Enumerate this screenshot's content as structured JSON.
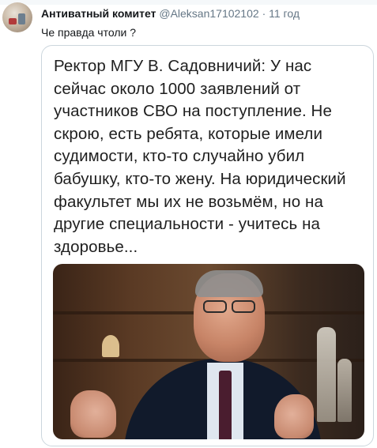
{
  "tweet": {
    "author_name": "Антиватный комитет",
    "author_handle": "@Aleksan17102102",
    "separator": "·",
    "time": "11 год",
    "text": "Че правда чтоли ?"
  },
  "quote_card": {
    "text": "Ректор МГУ В. Садовничий: У нас\nсейчас около 1000 заявлений от\nучастников СВО на поступление. Не\nскрою, есть ребята, которые имели\nсудимости, кто-то случайно убил\nбабушку, кто-то жену.  На юридический\nфакультет мы их не возьмём, но на\nдругие специальности - учитесь на\nздоровье..."
  },
  "colors": {
    "secondary_text": "#657786",
    "border": "#ccd6dd"
  }
}
